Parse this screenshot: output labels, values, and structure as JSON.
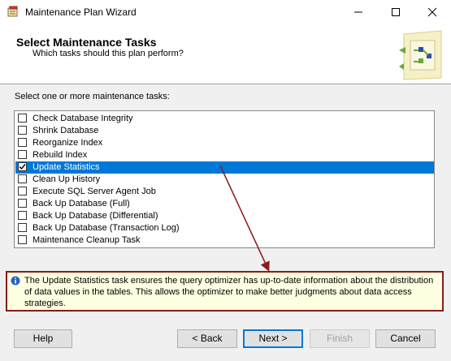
{
  "window": {
    "title": "Maintenance Plan Wizard",
    "icon": "wizard-app-icon"
  },
  "header": {
    "title": "Select Maintenance Tasks",
    "subtitle": "Which tasks should this plan perform?"
  },
  "task_list": {
    "label": "Select one or more maintenance tasks:",
    "items": [
      {
        "label": "Check Database Integrity",
        "checked": false,
        "selected": false
      },
      {
        "label": "Shrink Database",
        "checked": false,
        "selected": false
      },
      {
        "label": "Reorganize Index",
        "checked": false,
        "selected": false
      },
      {
        "label": "Rebuild Index",
        "checked": false,
        "selected": false
      },
      {
        "label": "Update Statistics",
        "checked": true,
        "selected": true
      },
      {
        "label": "Clean Up History",
        "checked": false,
        "selected": false
      },
      {
        "label": "Execute SQL Server Agent Job",
        "checked": false,
        "selected": false
      },
      {
        "label": "Back Up Database (Full)",
        "checked": false,
        "selected": false
      },
      {
        "label": "Back Up Database (Differential)",
        "checked": false,
        "selected": false
      },
      {
        "label": "Back Up Database (Transaction Log)",
        "checked": false,
        "selected": false
      },
      {
        "label": "Maintenance Cleanup Task",
        "checked": false,
        "selected": false
      }
    ]
  },
  "info": {
    "icon": "info-icon",
    "text": "The Update Statistics task ensures the query optimizer has up-to-date information about the distribution of data values in the tables. This allows the optimizer to make better judgments about data access strategies."
  },
  "buttons": {
    "help": "Help",
    "back": "< Back",
    "next": "Next >",
    "finish": "Finish",
    "cancel": "Cancel"
  },
  "colors": {
    "selection": "#0078d7",
    "info_background": "#ffffe1",
    "annotation": "#8b1a1a"
  }
}
